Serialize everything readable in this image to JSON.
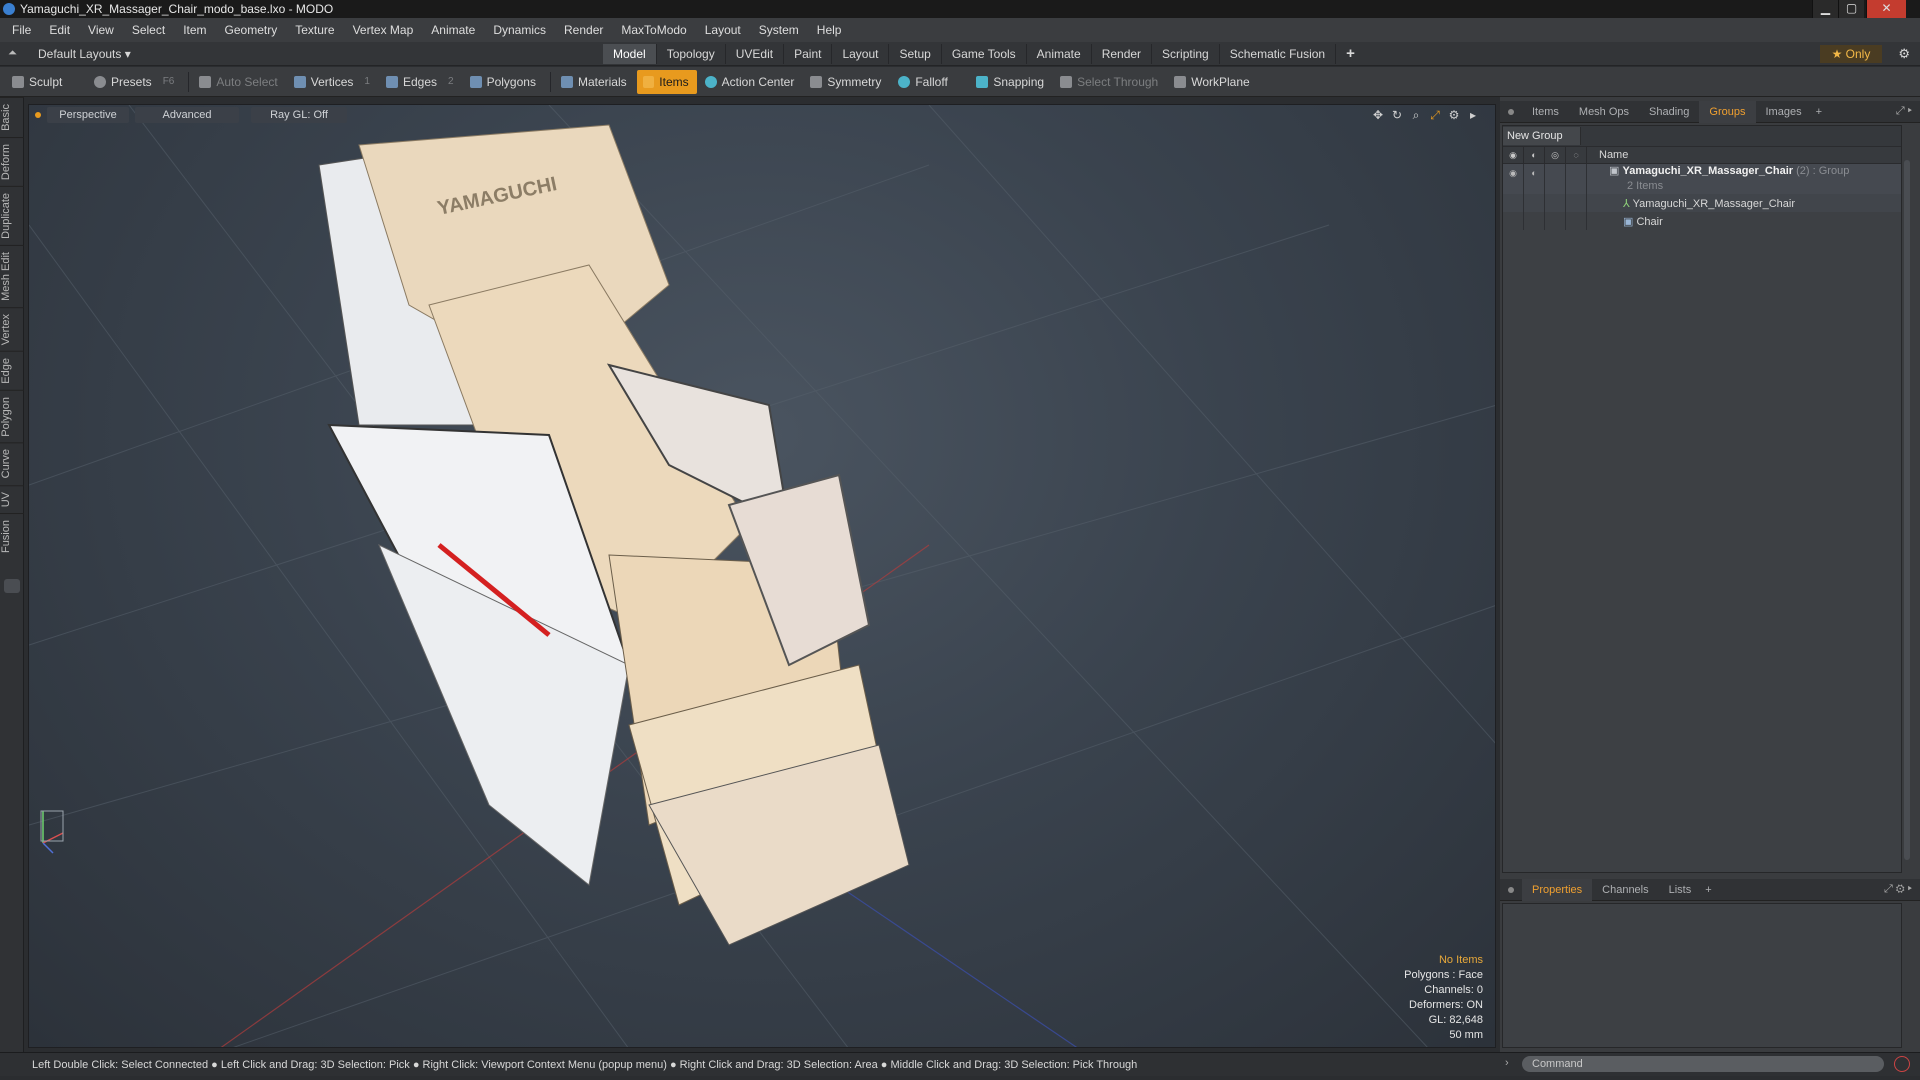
{
  "window": {
    "title": "Yamaguchi_XR_Massager_Chair_modo_base.lxo - MODO",
    "min": "▁",
    "max": "▢",
    "close": "✕"
  },
  "menu": [
    "File",
    "Edit",
    "View",
    "Select",
    "Item",
    "Geometry",
    "Texture",
    "Vertex Map",
    "Animate",
    "Dynamics",
    "Render",
    "MaxToModo",
    "Layout",
    "System",
    "Help"
  ],
  "layoutbar": {
    "layouts_label": "Default Layouts ▾",
    "tabs": [
      "Model",
      "Topology",
      "UVEdit",
      "Paint",
      "Layout",
      "Setup",
      "Game Tools",
      "Animate",
      "Render",
      "Scripting",
      "Schematic Fusion"
    ],
    "active_tab": "Model",
    "add": "+",
    "only_label": "★  Only",
    "gear": "⚙"
  },
  "toolbar": {
    "sculpt": "Sculpt",
    "presets": "Presets",
    "presets_key": "F6",
    "auto_select": "Auto Select",
    "vertices": "Vertices",
    "vertices_key": "1",
    "edges": "Edges",
    "edges_key": "2",
    "polygons": "Polygons",
    "materials": "Materials",
    "items": "Items",
    "action_center": "Action Center",
    "symmetry": "Symmetry",
    "falloff": "Falloff",
    "snapping": "Snapping",
    "select_through": "Select Through",
    "workplane": "WorkPlane"
  },
  "left_tabs": [
    "Basic",
    "Deform",
    "Duplicate",
    "Mesh Edit",
    "Vertex",
    "Edge",
    "Polygon",
    "Curve",
    "UV",
    "Fusion"
  ],
  "viewport": {
    "view": "Perspective",
    "shading": "Advanced",
    "raygl": "Ray GL: Off",
    "stats": {
      "selection": "No Items",
      "polygons": "Polygons : Face",
      "channels": "Channels: 0",
      "deformers": "Deformers: ON",
      "gl": "GL: 82,648",
      "lens": "50 mm"
    },
    "brand_text": "YAMAGUCHI"
  },
  "right_panel": {
    "tabs": [
      "Items",
      "Mesh Ops",
      "Shading",
      "Groups",
      "Images"
    ],
    "active_tab": "Groups",
    "new_group": "New Group",
    "name_header": "Name",
    "group": {
      "name": "Yamaguchi_XR_Massager_Chair",
      "count": "(2)",
      "type": ": Group",
      "items_label": "2 Items"
    },
    "children": [
      "Yamaguchi_XR_Massager_Chair",
      "Chair"
    ],
    "bottom_tabs": [
      "Properties",
      "Channels",
      "Lists"
    ],
    "bottom_active": "Properties"
  },
  "statusbar": {
    "hint": "Left Double Click: Select Connected ● Left Click and Drag: 3D Selection: Pick ● Right Click: Viewport Context Menu (popup menu) ● Right Click and Drag: 3D Selection: Area ● Middle Click and Drag: 3D Selection: Pick Through",
    "command_placeholder": "Command"
  },
  "colors": {
    "accent": "#e89a1e",
    "active_tab_text": "#f0a030",
    "viewport_bg": "#3a434e"
  }
}
